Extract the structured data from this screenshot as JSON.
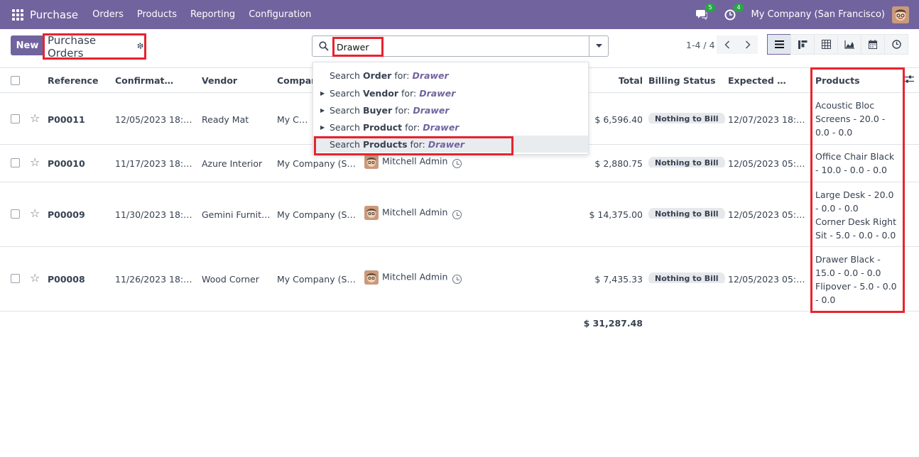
{
  "navbar": {
    "app_name": "Purchase",
    "menu": [
      "Orders",
      "Products",
      "Reporting",
      "Configuration"
    ],
    "messages_count": "5",
    "activities_count": "4",
    "company": "My Company (San Francisco)"
  },
  "control_panel": {
    "new_label": "New",
    "title": "Purchase Orders",
    "search_value": "Drawer",
    "pager": "1-4 / 4"
  },
  "search_dropdown": {
    "items": [
      {
        "prefix": "Search",
        "field": "Order",
        "suffix": "for:",
        "value": "Drawer",
        "expandable": false
      },
      {
        "prefix": "Search",
        "field": "Vendor",
        "suffix": "for:",
        "value": "Drawer",
        "expandable": true
      },
      {
        "prefix": "Search",
        "field": "Buyer",
        "suffix": "for:",
        "value": "Drawer",
        "expandable": true
      },
      {
        "prefix": "Search",
        "field": "Product",
        "suffix": "for:",
        "value": "Drawer",
        "expandable": true
      },
      {
        "prefix": "Search",
        "field": "Products",
        "suffix": "for:",
        "value": "Drawer",
        "expandable": false
      }
    ]
  },
  "table": {
    "headers": {
      "reference": "Reference",
      "confirmation": "Confirmatio…",
      "vendor": "Vendor",
      "company": "Company",
      "total": "Total",
      "billing": "Billing Status",
      "expected": "Expected Ar…",
      "products": "Products"
    },
    "rows": [
      {
        "reference": "P00011",
        "confirmation": "12/05/2023 18:27…",
        "vendor": "Ready Mat",
        "company": "My Compa",
        "buyer": "",
        "total": "$ 6,596.40",
        "billing": "Nothing to Bill",
        "expected": "12/07/2023 18:27…",
        "products": [
          "Acoustic Bloc Screens - 20.0 - 0.0 - 0.0"
        ]
      },
      {
        "reference": "P00010",
        "confirmation": "11/17/2023 18:27…",
        "vendor": "Azure Interior",
        "company": "My Company (San…",
        "buyer": "Mitchell Admin",
        "total": "$ 2,880.75",
        "billing": "Nothing to Bill",
        "expected": "12/05/2023 05:30…",
        "products": [
          "Office Chair Black - 10.0 - 0.0 - 0.0"
        ]
      },
      {
        "reference": "P00009",
        "confirmation": "11/30/2023 18:27…",
        "vendor": "Gemini Furniture",
        "company": "My Company (San…",
        "buyer": "Mitchell Admin",
        "total": "$ 14,375.00",
        "billing": "Nothing to Bill",
        "expected": "12/05/2023 05:30…",
        "products": [
          "Large Desk - 20.0 - 0.0 - 0.0",
          "Corner Desk Right Sit - 5.0 - 0.0 - 0.0"
        ]
      },
      {
        "reference": "P00008",
        "confirmation": "11/26/2023 18:27…",
        "vendor": "Wood Corner",
        "company": "My Company (San…",
        "buyer": "Mitchell Admin",
        "total": "$ 7,435.33",
        "billing": "Nothing to Bill",
        "expected": "12/05/2023 05:30…",
        "products": [
          "Drawer Black - 15.0 - 0.0 - 0.0",
          "Flipover - 5.0 - 0.0 - 0.0"
        ]
      }
    ],
    "grand_total": "$ 31,287.48"
  },
  "colors": {
    "brand": "#71639e",
    "highlight": "#e8232e",
    "badge": "#28a745"
  }
}
